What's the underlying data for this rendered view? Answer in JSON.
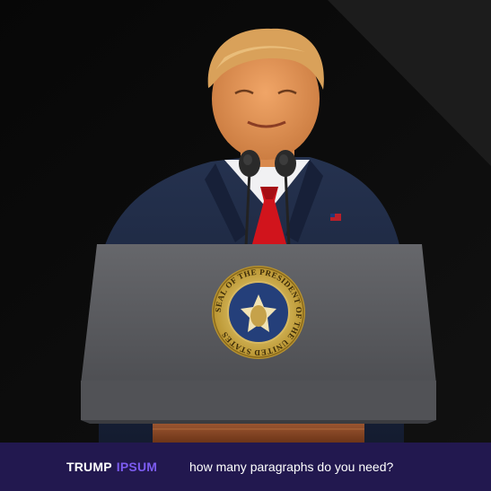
{
  "hero": {
    "seal_text": "SEAL OF THE PRESIDENT OF THE UNITED STATES",
    "colors": {
      "background": "#0a0a0a",
      "podium": "#5d5e62",
      "wood": "#8a4a2a",
      "suit": "#1d2a44",
      "tie": "#d1141c",
      "skin": "#e49a5b",
      "hair": "#d9a15a"
    }
  },
  "footer": {
    "brand_primary": "TRUMP",
    "brand_secondary": "IPSUM",
    "question": "how many paragraphs do you need?",
    "colors": {
      "bar": "#22184f",
      "accent": "#7c5cf0",
      "text": "#ffffff"
    }
  }
}
